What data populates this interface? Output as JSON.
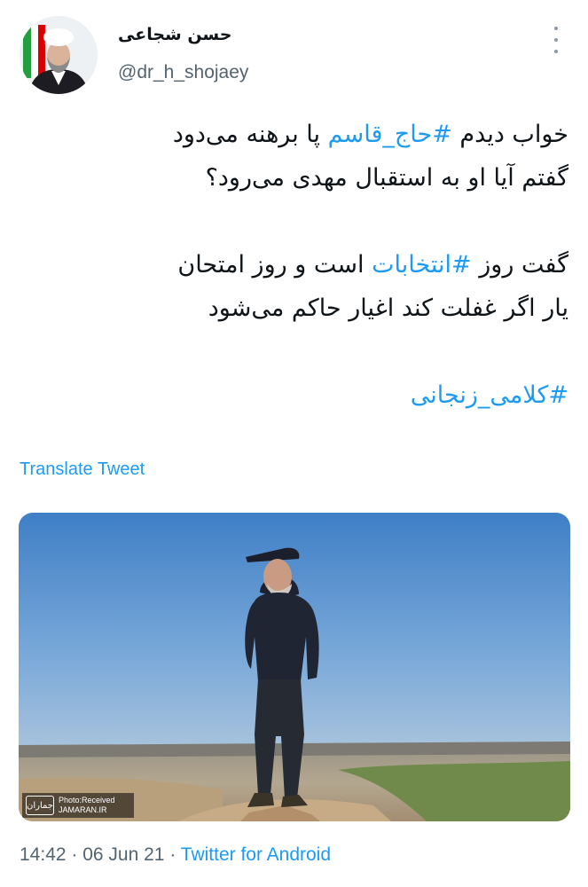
{
  "author": {
    "display_name": "حسن شجاعی",
    "handle": "@dr_h_shojaey",
    "avatar_icon": "profile-photo"
  },
  "tweet": {
    "line1": {
      "before": "خواب دیدم ",
      "hashtag": "#حاج_قاسم",
      "after": " پا برهنه می‌دود"
    },
    "line2": "گفتم آیا او به استقبال مهدی می‌رود؟",
    "line3": {
      "before": "گفت روز ",
      "hashtag": "#انتخابات",
      "after": " است و روز امتحان"
    },
    "line4": "یار اگر غفلت کند اغیار حاکم می‌شود",
    "line5_hashtag": "#کلامی_زنجانی"
  },
  "translate_label": "Translate Tweet",
  "media": {
    "watermark_logo": "جماران",
    "watermark_line1": "Photo:Received",
    "watermark_line2": "JAMARAN.IR"
  },
  "meta": {
    "time": "14:42",
    "separator1": " · ",
    "date": "06 Jun 21",
    "separator2": " · ",
    "source": "Twitter for Android"
  },
  "colors": {
    "accent": "#1d9bf0",
    "secondary_text": "#536471",
    "primary_text": "#0f1419"
  }
}
